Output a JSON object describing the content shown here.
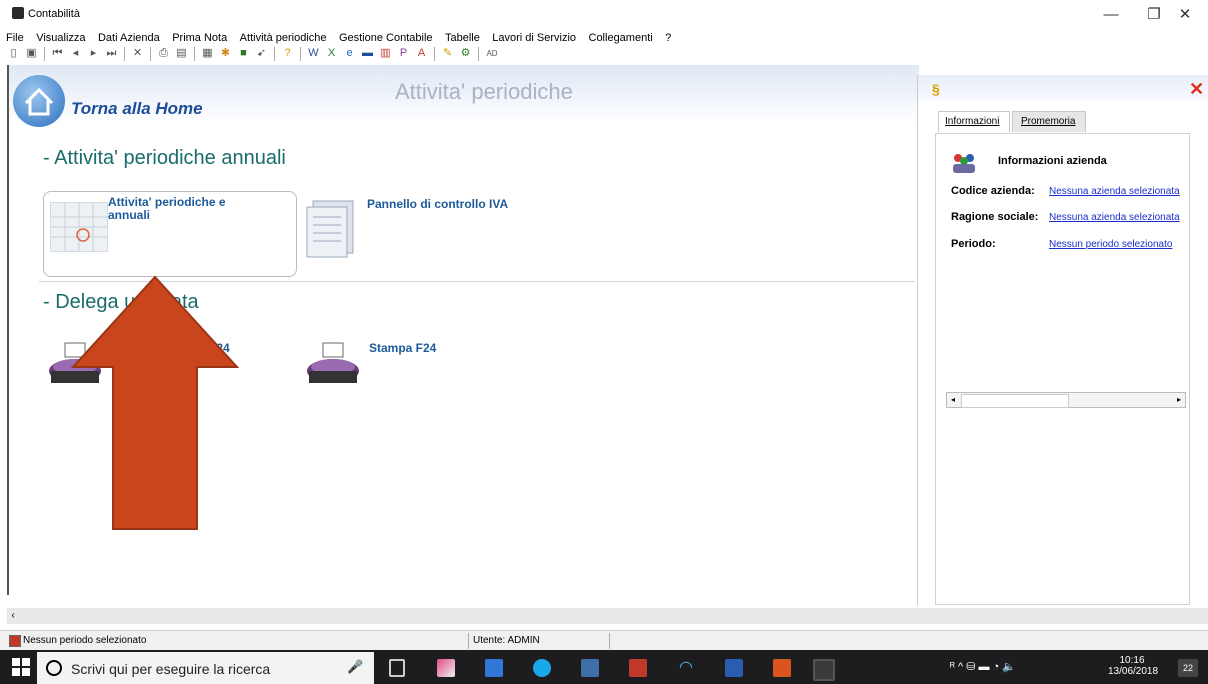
{
  "window": {
    "title": "Contabilità",
    "minimize": "—",
    "maximize": "❐",
    "close": "✕"
  },
  "menu": [
    "File",
    "Visualizza",
    "Dati Azienda",
    "Prima Nota",
    "Attività periodiche",
    "Gestione Contabile",
    "Tabelle",
    "Lavori di Servizio",
    "Collegamenti",
    "?"
  ],
  "toolbar": {
    "ad_label": "AD"
  },
  "main": {
    "home_label": "Torna alla Home",
    "page_title": "Attivita' periodiche",
    "section_annual": "- Attivita' periodiche annuali",
    "tile_annual": "Attivita' periodiche e annuali",
    "tile_iva": "Pannello di controllo IVA",
    "section_delega": "- Delega unificata",
    "tile_f24_partial": "F24",
    "tile_stampa": "Stampa F24"
  },
  "right_panel": {
    "tabs": [
      "Informazioni",
      "Promemoria"
    ],
    "heading": "Informazioni azienda",
    "rows": [
      {
        "label": "Codice azienda:",
        "value": "Nessuna azienda selezionata"
      },
      {
        "label": "Ragione sociale:",
        "value": "Nessuna azienda selezionata"
      },
      {
        "label": "Periodo:",
        "value": "Nessun periodo selezionato"
      }
    ]
  },
  "status": {
    "left": "Nessun periodo selezionato",
    "user": "Utente: ADMIN"
  },
  "taskbar": {
    "search_placeholder": "Scrivi qui per eseguire la ricerca",
    "time": "10:16",
    "date": "13/06/2018",
    "notifications": "22"
  },
  "colors": {
    "arrow": "#c9461d",
    "link": "#1a2ec8",
    "section": "#1a6c6a"
  }
}
